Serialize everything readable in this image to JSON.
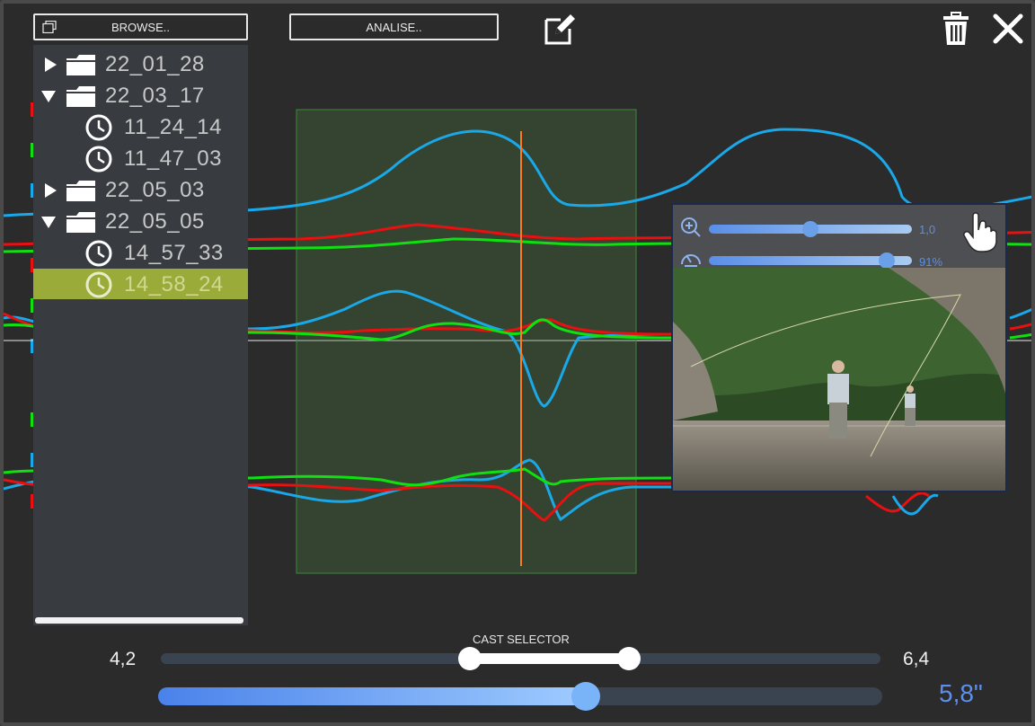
{
  "toolbar": {
    "browse_label": "BROWSE..",
    "analise_label": "ANALISE..",
    "edit_icon": "edit-icon",
    "trash_icon": "trash-icon",
    "close_icon": "close-icon"
  },
  "tree": {
    "items": [
      {
        "label": "22_01_28",
        "type": "folder",
        "expanded": false,
        "level": 0
      },
      {
        "label": "22_03_17",
        "type": "folder",
        "expanded": true,
        "level": 0
      },
      {
        "label": "11_24_14",
        "type": "session",
        "level": 1
      },
      {
        "label": "11_47_03",
        "type": "session",
        "level": 1
      },
      {
        "label": "22_05_03",
        "type": "folder",
        "expanded": false,
        "level": 0
      },
      {
        "label": "22_05_05",
        "type": "folder",
        "expanded": true,
        "level": 0
      },
      {
        "label": "14_57_33",
        "type": "session",
        "level": 1
      },
      {
        "label": "14_58_24",
        "type": "session",
        "level": 1,
        "selected": true
      }
    ]
  },
  "popup": {
    "zoom_value": "1,0",
    "zoom_level": 0.5,
    "speed_value": "91%",
    "speed_level": 0.91
  },
  "cast_selector": {
    "label": "CAST SELECTOR",
    "min_label": "4,2",
    "max_label": "6,4",
    "range_start": 0.43,
    "range_end": 0.65
  },
  "timeline": {
    "value_label": "5,8\"",
    "position": 0.59
  },
  "colors": {
    "background": "#2b2b2b",
    "selected_row": "#9bab3a",
    "accent_blue": "#5d8ff0",
    "series_blue": "#1aa8e8",
    "series_red": "#e81010",
    "series_green": "#10e010",
    "cursor_line": "#ff7a1a",
    "selection_box": "#2f4a2f"
  }
}
